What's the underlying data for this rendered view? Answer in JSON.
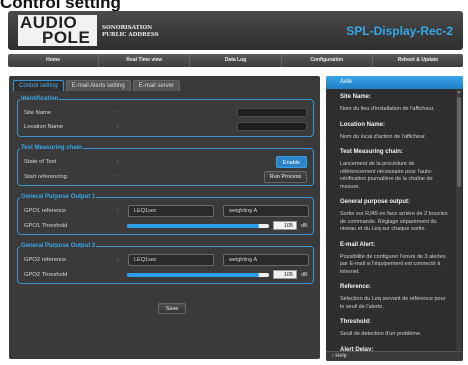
{
  "page": {
    "heading": "Control setting"
  },
  "brand": {
    "logo_line1": "AUDIO",
    "logo_line2": "POLE",
    "tagline_1": "SONORISATION",
    "tagline_2": "PUBLIC ADDRESS",
    "device_name": "SPL-Display-Rec-2",
    "accent_color": "#35a7e6"
  },
  "nav": [
    "Home",
    "Real Time view",
    "Data Log",
    "Configuration",
    "Reboot & Update"
  ],
  "tabs": [
    {
      "label": "Control setting",
      "active": true
    },
    {
      "label": "E-mail Alerts setting",
      "active": false
    },
    {
      "label": "E-mail server",
      "active": false
    }
  ],
  "identification": {
    "title": "Identification",
    "site_name_label": "Site Name",
    "site_name_value": "",
    "location_name_label": "Location Name",
    "location_name_value": ""
  },
  "test_chain": {
    "title": "Test Measuring chain",
    "state_label": "State of Test",
    "enable_button": "Enable",
    "start_label": "Start referencing",
    "run_button": "Run Process"
  },
  "gpo1": {
    "title": "General Purpose Output 1",
    "reference_label": "GPO1 reference",
    "reference_value": "LEQ1sec",
    "weighting_value": "weighting A",
    "threshold_label": "GPO1 Threshold",
    "threshold_value": "105",
    "threshold_fraction": 0.93,
    "unit": "dB"
  },
  "gpo2": {
    "title": "General Purpose Output 2",
    "reference_label": "GPO2 reference",
    "reference_value": "LEQ1sec",
    "weighting_value": "weighting A",
    "threshold_label": "GPO2 Threshold",
    "threshold_value": "105",
    "threshold_fraction": 0.93,
    "unit": "dB"
  },
  "save_button": "Save",
  "colon": ":",
  "aside": {
    "title": "Aide",
    "footer": "Help",
    "sections": [
      {
        "heading": "Site Name:",
        "text": "Nom du lieu d'installation de l'afficheur."
      },
      {
        "heading": "Location Name:",
        "text": "Nom du local d'action de l'afficheur."
      },
      {
        "heading": "Test Measuring chain:",
        "text": "Lancement de la procédure de référencement nécessaire pour l'auto-vérification journalière de la chaîne de mesure."
      },
      {
        "heading": "General purpose output:",
        "text": "Sortie sur RJ45 en face arrière de 2 boucles de commande. Réglage séparément du niveau et du Leq sur chaque sortie."
      },
      {
        "heading": "E-mail Alert:",
        "text": "Possibilité de configurer l'envoi de 3 alertes par E-mail si l'équipement est connecté à internet."
      },
      {
        "heading": "Reference:",
        "text": "Sélection du Leq servant de référence pour le seuil de l'alerte."
      },
      {
        "heading": "Threshold:",
        "text": "Seuil de detection d'un problème."
      },
      {
        "heading": "Alert Delay:",
        "text": ""
      }
    ]
  }
}
